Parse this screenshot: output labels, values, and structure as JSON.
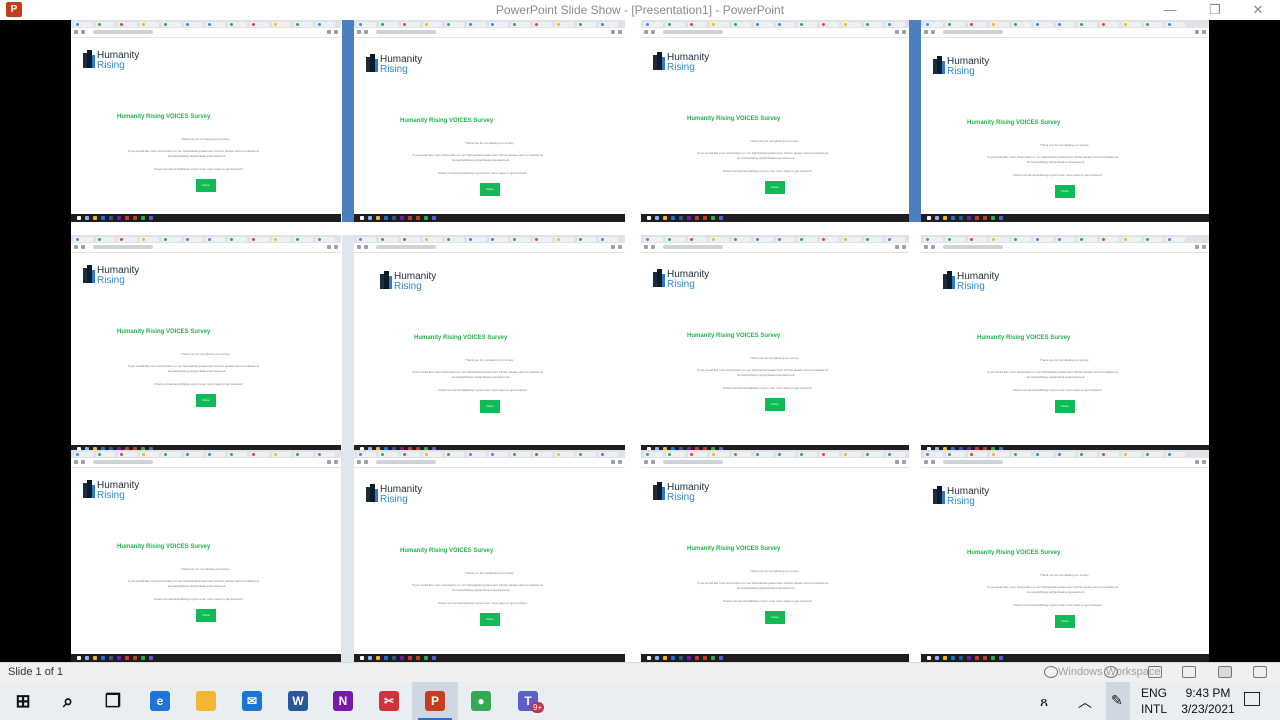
{
  "window": {
    "title": "PowerPoint Slide Show - [Presentation1] - PowerPoint",
    "app_icon": "powerpoint-icon",
    "minimize_glyph": "—",
    "restore_glyph": "❐",
    "close_glyph": "✕"
  },
  "slide": {
    "screenshot": {
      "logo_line1": "Humanity",
      "logo_line2": "Rising",
      "survey_title": "Humanity Rising VOICES Survey",
      "thank_you": "Thank you for completing our survey.",
      "info_line1": "If you would like more information on our Spiritual Empowerment Circles please visit our website at",
      "info_line2": "HumanityRising.org/spiritual-empowerment.",
      "check_out": "Check out HumanityRising.org for even more ways to get involved!",
      "button": "Done"
    },
    "tiles_count_label": ""
  },
  "statusbar": {
    "slide_indicator": "Slide 1 of 1",
    "watermark": "Windows Workspace"
  },
  "taskbar": {
    "items": [
      {
        "name": "start-button",
        "icon": "windows-icon",
        "glyph": "⊞",
        "color": "#111111"
      },
      {
        "name": "search-button",
        "icon": "search-icon",
        "glyph": "⌕",
        "color": "#111111"
      },
      {
        "name": "task-view-button",
        "icon": "task-view-icon",
        "glyph": "❐",
        "color": "#111111"
      },
      {
        "name": "edge-button",
        "icon": "edge-icon",
        "glyph": "e",
        "color": "#1f74d6"
      },
      {
        "name": "file-explorer-button",
        "icon": "folder-icon",
        "glyph": "",
        "color": "#f2b632"
      },
      {
        "name": "mail-button",
        "icon": "mail-icon",
        "glyph": "✉",
        "color": "#1976d2"
      },
      {
        "name": "word-button",
        "icon": "word-icon",
        "glyph": "W",
        "color": "#2b579a"
      },
      {
        "name": "onenote-button",
        "icon": "onenote-icon",
        "glyph": "N",
        "color": "#7719aa"
      },
      {
        "name": "snip-button",
        "icon": "snip-icon",
        "glyph": "✂",
        "color": "#d13438"
      },
      {
        "name": "powerpoint-button",
        "icon": "powerpoint-icon",
        "glyph": "P",
        "color": "#c43e1c",
        "active": true
      },
      {
        "name": "chrome-button",
        "icon": "chrome-icon",
        "glyph": "●",
        "color": "#34a853"
      },
      {
        "name": "teams-button",
        "icon": "teams-icon",
        "glyph": "T",
        "color": "#5b5fc7",
        "badge": "9+"
      }
    ],
    "language_top": "ENG",
    "language_bottom": "INTL",
    "time": "9:43 PM",
    "date": "3/23/2021"
  }
}
